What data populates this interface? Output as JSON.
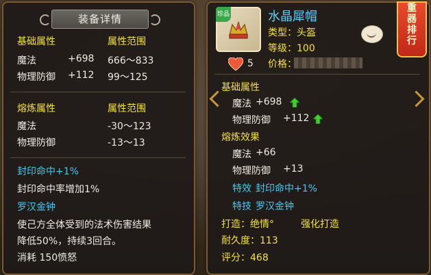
{
  "left_panel": {
    "title": "装备详情",
    "base": {
      "header": "基础属性",
      "range_header": "属性范围",
      "rows": [
        {
          "name": "魔法",
          "value": "+698",
          "range": "666～833"
        },
        {
          "name": "物理防御",
          "value": "+112",
          "range": "99～125"
        }
      ]
    },
    "refine": {
      "header": "熔炼属性",
      "range_header": "属性范围",
      "rows": [
        {
          "name": "魔法",
          "range": "-30～123"
        },
        {
          "name": "物理防御",
          "range": "-13～13"
        }
      ]
    },
    "effect_name": "封印命中+1%",
    "effect_desc": "封印命中率增加1%",
    "skill_name": "罗汉金钟",
    "skill_desc_1": "使己方全体受到的法术伤害结果",
    "skill_desc_2": "降低50%，持续3回合。",
    "skill_cost": "消耗 150愤怒"
  },
  "right_panel": {
    "badge": "珍品",
    "item_name": "水晶犀帽",
    "type": "类型：头盔",
    "level": "等级：100",
    "price": "价格：",
    "likes": "5",
    "rank_button": [
      "重",
      "器",
      "排",
      "行"
    ],
    "base_header": "基础属性",
    "base_rows": [
      {
        "name": "魔法",
        "value": "+698"
      },
      {
        "name": "物理防御",
        "value": "+112"
      }
    ],
    "refine_header": "熔炼效果",
    "refine_rows": [
      {
        "name": "魔法",
        "value": "+66"
      },
      {
        "name": "物理防御",
        "value": "+13"
      }
    ],
    "special_effect_label": "特效",
    "special_effect": "封印命中+1%",
    "special_skill_label": "特技",
    "special_skill": "罗汉金钟",
    "forge": "打造：绝情°",
    "forge_type": "强化打造",
    "durability": "耐久度：113",
    "score": "评分：468"
  },
  "colors": {
    "yellow": "#f5e23a",
    "cyan": "#48c8f0",
    "white": "#f0ece2",
    "green": "#44dd44"
  }
}
